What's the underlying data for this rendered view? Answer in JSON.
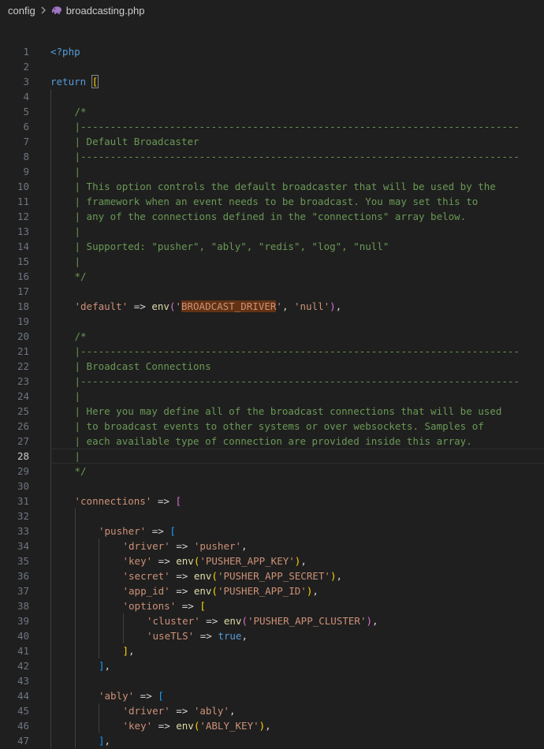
{
  "breadcrumb": {
    "folder": "config",
    "file": "broadcasting.php"
  },
  "editor": {
    "current_line": 28,
    "lines": [
      {
        "n": "1",
        "indent": 0,
        "tokens": [
          {
            "t": "<?php",
            "c": "kw"
          }
        ]
      },
      {
        "n": "2",
        "indent": 0,
        "tokens": []
      },
      {
        "n": "3",
        "indent": 0,
        "tokens": [
          {
            "t": "return ",
            "c": "ret"
          },
          {
            "t": "[",
            "c": "b1m"
          }
        ]
      },
      {
        "n": "4",
        "indent": 1,
        "tokens": []
      },
      {
        "n": "5",
        "indent": 1,
        "tokens": [
          {
            "t": "/*",
            "c": "com"
          }
        ]
      },
      {
        "n": "6",
        "indent": 1,
        "tokens": [
          {
            "t": "|--------------------------------------------------------------------------",
            "c": "com"
          }
        ]
      },
      {
        "n": "7",
        "indent": 1,
        "tokens": [
          {
            "t": "| Default Broadcaster",
            "c": "com"
          }
        ]
      },
      {
        "n": "8",
        "indent": 1,
        "tokens": [
          {
            "t": "|--------------------------------------------------------------------------",
            "c": "com"
          }
        ]
      },
      {
        "n": "9",
        "indent": 1,
        "tokens": [
          {
            "t": "|",
            "c": "com"
          }
        ]
      },
      {
        "n": "10",
        "indent": 1,
        "tokens": [
          {
            "t": "| This option controls the default broadcaster that will be used by the",
            "c": "com"
          }
        ]
      },
      {
        "n": "11",
        "indent": 1,
        "tokens": [
          {
            "t": "| framework when an event needs to be broadcast. You may set this to",
            "c": "com"
          }
        ]
      },
      {
        "n": "12",
        "indent": 1,
        "tokens": [
          {
            "t": "| any of the connections defined in the \"connections\" array below.",
            "c": "com"
          }
        ]
      },
      {
        "n": "13",
        "indent": 1,
        "tokens": [
          {
            "t": "|",
            "c": "com"
          }
        ]
      },
      {
        "n": "14",
        "indent": 1,
        "tokens": [
          {
            "t": "| Supported: \"pusher\", \"ably\", \"redis\", \"log\", \"null\"",
            "c": "com"
          }
        ]
      },
      {
        "n": "15",
        "indent": 1,
        "tokens": [
          {
            "t": "|",
            "c": "com"
          }
        ]
      },
      {
        "n": "16",
        "indent": 1,
        "tokens": [
          {
            "t": "*/",
            "c": "com"
          }
        ]
      },
      {
        "n": "17",
        "indent": 1,
        "tokens": []
      },
      {
        "n": "18",
        "indent": 1,
        "tokens": [
          {
            "t": "'default'",
            "c": "str"
          },
          {
            "t": " => ",
            "c": "op"
          },
          {
            "t": "env",
            "c": "fn"
          },
          {
            "t": "(",
            "c": "b2"
          },
          {
            "t": "'",
            "c": "str"
          },
          {
            "t": "BROADCAST_DRIVER",
            "c": "hl"
          },
          {
            "t": "'",
            "c": "str"
          },
          {
            "t": ", ",
            "c": "op"
          },
          {
            "t": "'null'",
            "c": "str"
          },
          {
            "t": ")",
            "c": "b2"
          },
          {
            "t": ",",
            "c": "op"
          }
        ]
      },
      {
        "n": "19",
        "indent": 1,
        "tokens": []
      },
      {
        "n": "20",
        "indent": 1,
        "tokens": [
          {
            "t": "/*",
            "c": "com"
          }
        ]
      },
      {
        "n": "21",
        "indent": 1,
        "tokens": [
          {
            "t": "|--------------------------------------------------------------------------",
            "c": "com"
          }
        ]
      },
      {
        "n": "22",
        "indent": 1,
        "tokens": [
          {
            "t": "| Broadcast Connections",
            "c": "com"
          }
        ]
      },
      {
        "n": "23",
        "indent": 1,
        "tokens": [
          {
            "t": "|--------------------------------------------------------------------------",
            "c": "com"
          }
        ]
      },
      {
        "n": "24",
        "indent": 1,
        "tokens": [
          {
            "t": "|",
            "c": "com"
          }
        ]
      },
      {
        "n": "25",
        "indent": 1,
        "tokens": [
          {
            "t": "| Here you may define all of the broadcast connections that will be used",
            "c": "com"
          }
        ]
      },
      {
        "n": "26",
        "indent": 1,
        "tokens": [
          {
            "t": "| to broadcast events to other systems or over websockets. Samples of",
            "c": "com"
          }
        ]
      },
      {
        "n": "27",
        "indent": 1,
        "tokens": [
          {
            "t": "| each available type of connection are provided inside this array.",
            "c": "com"
          }
        ]
      },
      {
        "n": "28",
        "indent": 1,
        "tokens": [
          {
            "t": "|",
            "c": "com"
          }
        ]
      },
      {
        "n": "29",
        "indent": 1,
        "tokens": [
          {
            "t": "*/",
            "c": "com"
          }
        ]
      },
      {
        "n": "30",
        "indent": 1,
        "tokens": []
      },
      {
        "n": "31",
        "indent": 1,
        "tokens": [
          {
            "t": "'connections'",
            "c": "str"
          },
          {
            "t": " => ",
            "c": "op"
          },
          {
            "t": "[",
            "c": "b2"
          }
        ]
      },
      {
        "n": "32",
        "indent": 2,
        "tokens": []
      },
      {
        "n": "33",
        "indent": 2,
        "tokens": [
          {
            "t": "'pusher'",
            "c": "str"
          },
          {
            "t": " => ",
            "c": "op"
          },
          {
            "t": "[",
            "c": "b3"
          }
        ]
      },
      {
        "n": "34",
        "indent": 3,
        "tokens": [
          {
            "t": "'driver'",
            "c": "str"
          },
          {
            "t": " => ",
            "c": "op"
          },
          {
            "t": "'pusher'",
            "c": "str"
          },
          {
            "t": ",",
            "c": "op"
          }
        ]
      },
      {
        "n": "35",
        "indent": 3,
        "tokens": [
          {
            "t": "'key'",
            "c": "str"
          },
          {
            "t": " => ",
            "c": "op"
          },
          {
            "t": "env",
            "c": "fn"
          },
          {
            "t": "(",
            "c": "b1"
          },
          {
            "t": "'PUSHER_APP_KEY'",
            "c": "str"
          },
          {
            "t": ")",
            "c": "b1"
          },
          {
            "t": ",",
            "c": "op"
          }
        ]
      },
      {
        "n": "36",
        "indent": 3,
        "tokens": [
          {
            "t": "'secret'",
            "c": "str"
          },
          {
            "t": " => ",
            "c": "op"
          },
          {
            "t": "env",
            "c": "fn"
          },
          {
            "t": "(",
            "c": "b1"
          },
          {
            "t": "'PUSHER_APP_SECRET'",
            "c": "str"
          },
          {
            "t": ")",
            "c": "b1"
          },
          {
            "t": ",",
            "c": "op"
          }
        ]
      },
      {
        "n": "37",
        "indent": 3,
        "tokens": [
          {
            "t": "'app_id'",
            "c": "str"
          },
          {
            "t": " => ",
            "c": "op"
          },
          {
            "t": "env",
            "c": "fn"
          },
          {
            "t": "(",
            "c": "b1"
          },
          {
            "t": "'PUSHER_APP_ID'",
            "c": "str"
          },
          {
            "t": ")",
            "c": "b1"
          },
          {
            "t": ",",
            "c": "op"
          }
        ]
      },
      {
        "n": "38",
        "indent": 3,
        "tokens": [
          {
            "t": "'options'",
            "c": "str"
          },
          {
            "t": " => ",
            "c": "op"
          },
          {
            "t": "[",
            "c": "b1"
          }
        ]
      },
      {
        "n": "39",
        "indent": 4,
        "tokens": [
          {
            "t": "'cluster'",
            "c": "str"
          },
          {
            "t": " => ",
            "c": "op"
          },
          {
            "t": "env",
            "c": "fn"
          },
          {
            "t": "(",
            "c": "b2"
          },
          {
            "t": "'PUSHER_APP_CLUSTER'",
            "c": "str"
          },
          {
            "t": ")",
            "c": "b2"
          },
          {
            "t": ",",
            "c": "op"
          }
        ]
      },
      {
        "n": "40",
        "indent": 4,
        "tokens": [
          {
            "t": "'useTLS'",
            "c": "str"
          },
          {
            "t": " => ",
            "c": "op"
          },
          {
            "t": "true",
            "c": "bool"
          },
          {
            "t": ",",
            "c": "op"
          }
        ]
      },
      {
        "n": "41",
        "indent": 3,
        "tokens": [
          {
            "t": "]",
            "c": "b1"
          },
          {
            "t": ",",
            "c": "op"
          }
        ]
      },
      {
        "n": "42",
        "indent": 2,
        "tokens": [
          {
            "t": "]",
            "c": "b3"
          },
          {
            "t": ",",
            "c": "op"
          }
        ]
      },
      {
        "n": "43",
        "indent": 2,
        "tokens": []
      },
      {
        "n": "44",
        "indent": 2,
        "tokens": [
          {
            "t": "'ably'",
            "c": "str"
          },
          {
            "t": " => ",
            "c": "op"
          },
          {
            "t": "[",
            "c": "b3"
          }
        ]
      },
      {
        "n": "45",
        "indent": 3,
        "tokens": [
          {
            "t": "'driver'",
            "c": "str"
          },
          {
            "t": " => ",
            "c": "op"
          },
          {
            "t": "'ably'",
            "c": "str"
          },
          {
            "t": ",",
            "c": "op"
          }
        ]
      },
      {
        "n": "46",
        "indent": 3,
        "tokens": [
          {
            "t": "'key'",
            "c": "str"
          },
          {
            "t": " => ",
            "c": "op"
          },
          {
            "t": "env",
            "c": "fn"
          },
          {
            "t": "(",
            "c": "b1"
          },
          {
            "t": "'ABLY_KEY'",
            "c": "str"
          },
          {
            "t": ")",
            "c": "b1"
          },
          {
            "t": ",",
            "c": "op"
          }
        ]
      },
      {
        "n": "47",
        "indent": 2,
        "tokens": [
          {
            "t": "]",
            "c": "b3"
          },
          {
            "t": ",",
            "c": "op"
          }
        ]
      }
    ]
  },
  "colors": {
    "background": "#1f1f1f",
    "comment": "#6a9955",
    "string": "#ce9178",
    "keyword": "#569cd6",
    "function": "#dcdcaa",
    "bracket_gold": "#ffd700",
    "bracket_purple": "#da70d6",
    "bracket_blue": "#179fff",
    "highlight_bg": "#613214"
  },
  "icons": {
    "folder_separator": "chevron-right-icon",
    "file": "php-elephant-icon"
  }
}
